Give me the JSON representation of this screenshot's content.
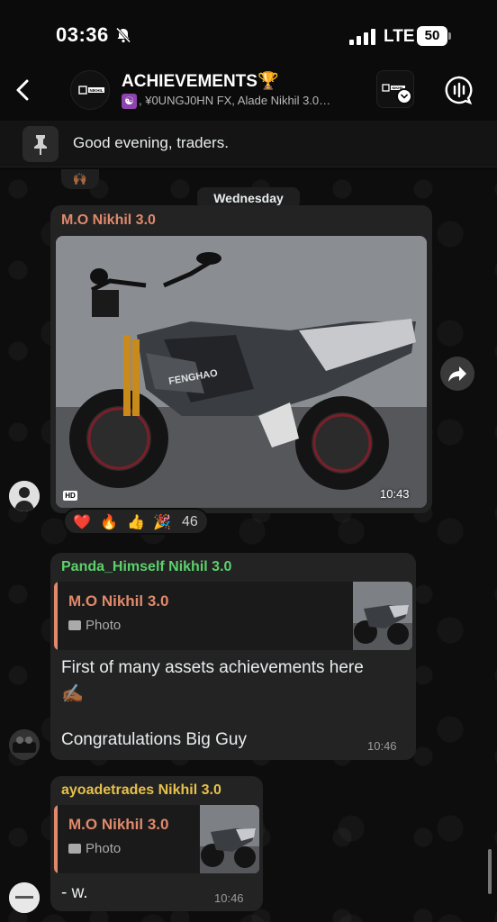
{
  "status_bar": {
    "time": "03:36",
    "network": "LTE",
    "battery": "50"
  },
  "header": {
    "title": "ACHIEVEMENTS",
    "title_emoji": "🏆",
    "members": ", ¥0UNGJ0HN FX, Alade Nikhil 3.0…",
    "members_emoji": "☯",
    "group_avatar_text": "NIKHIL",
    "channel_avatar_text": "NIKHIL"
  },
  "pinned": {
    "text": "Good evening, traders."
  },
  "partial_reaction": "🙌🏾",
  "date_chip": "Wednesday",
  "messages": [
    {
      "sender": "M.O Nikhil 3.0",
      "sender_color": "#e0896b",
      "type": "photo",
      "photo_label": "FENGHAO",
      "hd": "HD",
      "time": "10:43",
      "reactions": [
        "❤️",
        "🔥",
        "👍",
        "🎉"
      ],
      "reaction_count": "46"
    },
    {
      "sender": "Panda_Himself Nikhil 3.0",
      "sender_color": "#5bd16b",
      "reply": {
        "name": "M.O Nikhil 3.0",
        "kind": "Photo"
      },
      "text_line1": "First of many assets achievements here",
      "text_emoji": "✍🏾",
      "text_line2": "Congratulations Big Guy",
      "time": "10:46"
    },
    {
      "sender": "ayoadetrades Nikhil 3.0",
      "sender_color": "#e6c04a",
      "reply": {
        "name": "M.O Nikhil 3.0",
        "kind": "Photo"
      },
      "text": "-  w.",
      "time": "10:46"
    }
  ]
}
